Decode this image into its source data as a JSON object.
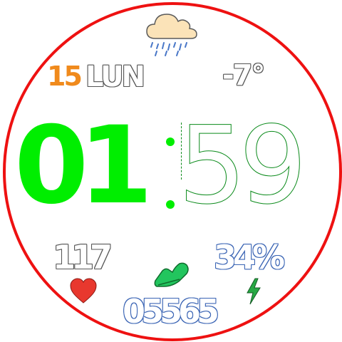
{
  "date": {
    "day": "15",
    "weekday": "LUN"
  },
  "weather": {
    "temperature": "-7°",
    "icon": "cloud-rain-icon"
  },
  "time": {
    "hours": "01",
    "minutes": "59"
  },
  "stats": {
    "heart_rate": "117",
    "battery": "34%",
    "steps": "05565"
  },
  "icons": {
    "heart": "heart-icon",
    "battery": "lightning-bolt-icon",
    "steps": "sneaker-icon"
  },
  "colors": {
    "bezel": "#ee1111",
    "hours": "#00ee00",
    "minutes_outline": "#0a8a1a",
    "day": "#f08a1c",
    "heart": "#e8382e",
    "steps_icon": "#22c55e",
    "bolt": "#27a844",
    "cloud": "#fbe3b8"
  }
}
